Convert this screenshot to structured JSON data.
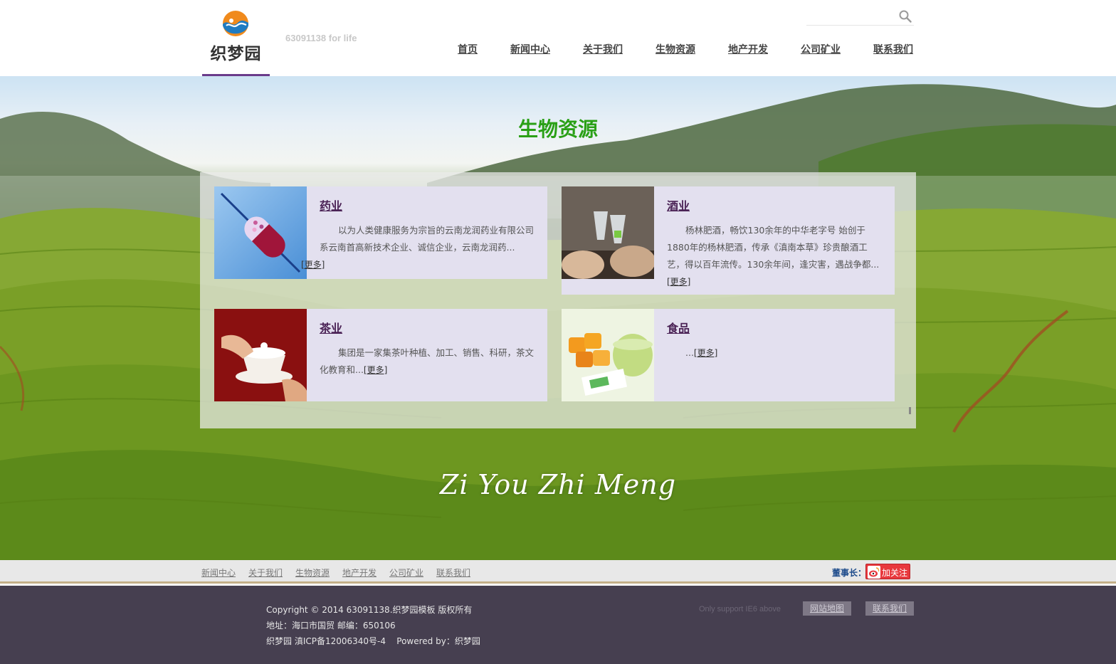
{
  "header": {
    "logo_text": "织梦园",
    "slogan": "63091138 for life",
    "search": {
      "value": "",
      "placeholder": ""
    },
    "nav": [
      {
        "label": "首页"
      },
      {
        "label": "新闻中心"
      },
      {
        "label": "关于我们"
      },
      {
        "label": "生物资源"
      },
      {
        "label": "地产开发"
      },
      {
        "label": "公司矿业"
      },
      {
        "label": "联系我们"
      }
    ]
  },
  "banner": {
    "title": "生物资源",
    "script_text": "Zi You Zhi Meng",
    "cards": [
      {
        "title": "药业",
        "desc": "以为人类健康服务为宗旨的云南龙润药业有限公司系云南首高新技术企业、诚信企业，云南龙润药...",
        "more": "[更多]",
        "image": "medicine-capsule-image"
      },
      {
        "title": "酒业",
        "desc": "杨林肥酒，畅饮130余年的中华老字号 始创于1880年的杨林肥酒，传承《滇南本草》珍贵酿酒工艺，得以百年流传。130余年间，逢灾害，遇战争都...",
        "more": "[更多]",
        "image": "wine-toast-image"
      },
      {
        "title": "茶业",
        "desc": "集团是一家集茶叶种植、加工、销售、科研，茶文化教育和...",
        "more": "[更多]",
        "image": "tea-cup-image"
      },
      {
        "title": "食品",
        "desc": "...",
        "more": "[更多]",
        "image": "food-jelly-image"
      }
    ]
  },
  "footnav": {
    "links": [
      {
        "label": "新闻中心"
      },
      {
        "label": "关于我们"
      },
      {
        "label": "生物资源"
      },
      {
        "label": "地产开发"
      },
      {
        "label": "公司矿业"
      },
      {
        "label": "联系我们"
      }
    ],
    "weibo_label": "董事长：",
    "weibo_button": "加关注"
  },
  "footer": {
    "copyright": "Copyright © 2014 63091138.织梦园模板 版权所有",
    "address": "地址：海口市国贸 邮编：650106",
    "icp": "织梦园 滇ICP备12006340号-4    Powered by：织梦园",
    "support": "Only support IE6 above",
    "sitemap": "网站地图",
    "contact": "联系我们"
  },
  "colors": {
    "accent_purple": "#6a3b8a",
    "title_green": "#2aa016",
    "card_bg": "#e3e0ef",
    "footer_bg": "#463f50",
    "weibo_red": "#e8383d"
  }
}
